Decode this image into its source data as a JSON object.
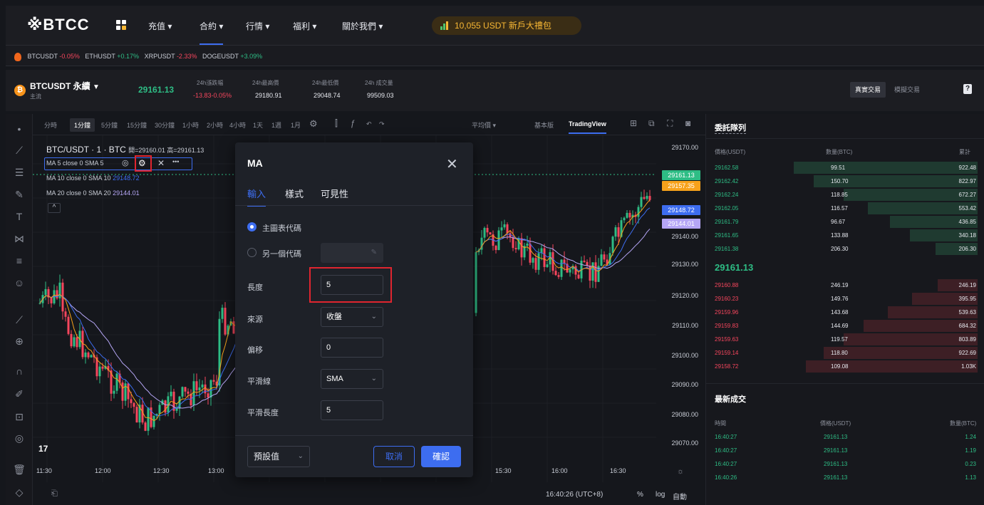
{
  "header": {
    "logo": "※BTCC",
    "nav": [
      "充值 ▾",
      "合約 ▾",
      "行情 ▾",
      "福利 ▾",
      "關於我們 ▾"
    ],
    "promo": "10,055 USDT 新戶大禮包"
  },
  "ticker": [
    {
      "sym": "BTCUSDT",
      "chg": "-0.05%",
      "dir": "neg"
    },
    {
      "sym": "ETHUSDT",
      "chg": "+0.17%",
      "dir": "pos"
    },
    {
      "sym": "XRPUSDT",
      "chg": "-2.33%",
      "dir": "neg"
    },
    {
      "sym": "DOGEUSDT",
      "chg": "+3.09%",
      "dir": "pos"
    }
  ],
  "info": {
    "pair": "BTCUSDT 永續",
    "sub": "主流",
    "price": "29161.13",
    "change_label": "24h漲跌幅",
    "change_value": "-13.83-0.05%",
    "high_label": "24h最高價",
    "high_value": "29180.91",
    "low_label": "24h最低價",
    "low_value": "29048.74",
    "vol_label": "24h 成交量",
    "vol_value": "99509.03",
    "real": "真實交易",
    "demo": "模擬交易",
    "help": "?"
  },
  "toolbar": {
    "intervals": [
      "分時",
      "1分鐘",
      "5分鐘",
      "15分鐘",
      "30分鐘",
      "1小時",
      "2小時",
      "4小時",
      "1天",
      "1週",
      "1月"
    ],
    "indicator": "平均價 ▾",
    "basic": "基本版",
    "tv": "TradingView"
  },
  "legend": {
    "title": "BTC/USDT · 1 · BTC",
    "ohlc": "開=29160.01 高=29161.13",
    "ma5": "MA 5 close 0 SMA 5",
    "ma10": "MA 10 close 0 SMA 10",
    "ma10_val": "29148.72",
    "ma20": "MA 20 close 0 SMA 20",
    "ma20_val": "29144.01"
  },
  "price_axis": [
    "29170.00",
    "29150.00",
    "29140.00",
    "29130.00",
    "29120.00",
    "29110.00",
    "29100.00",
    "29090.00",
    "29080.00",
    "29070.00"
  ],
  "price_tags": [
    {
      "v": "29161.13",
      "color": "#2ebd85"
    },
    {
      "v": "29157.35",
      "color": "#f7a21b"
    },
    {
      "v": "29148.72",
      "color": "#3d6df0"
    },
    {
      "v": "29144.01",
      "color": "#b5a6f5"
    }
  ],
  "time_axis": [
    "11:30",
    "12:00",
    "12:30",
    "13:00",
    "15:30",
    "16:00",
    "16:30"
  ],
  "footer": {
    "clock": "16:40:26 (UTC+8)",
    "pct": "%",
    "log": "log",
    "auto": "自動"
  },
  "modal": {
    "title": "MA",
    "tabs": [
      "輸入",
      "樣式",
      "可見性"
    ],
    "main_symbol": "主圖表代碼",
    "other_symbol": "另一個代碼",
    "length_label": "長度",
    "length_value": "5",
    "source_label": "來源",
    "source_value": "收盤",
    "offset_label": "偏移",
    "offset_value": "0",
    "smooth_label": "平滑線",
    "smooth_value": "SMA",
    "smooth_len_label": "平滑長度",
    "smooth_len_value": "5",
    "preset": "預設值",
    "cancel": "取消",
    "ok": "確認"
  },
  "orderbook": {
    "title": "委託隊列",
    "headers": [
      "價格(USDT)",
      "數量(BTC)",
      "累計"
    ],
    "asks": [
      [
        "29162.58",
        "99.51",
        "922.48",
        0.92
      ],
      [
        "29162.42",
        "150.70",
        "822.97",
        0.82
      ],
      [
        "29162.24",
        "118.85",
        "672.27",
        0.67
      ],
      [
        "29162.05",
        "116.57",
        "553.42",
        0.55
      ],
      [
        "29161.79",
        "96.67",
        "436.85",
        0.44
      ],
      [
        "29161.65",
        "133.88",
        "340.18",
        0.34
      ],
      [
        "29161.38",
        "206.30",
        "206.30",
        0.21
      ]
    ],
    "mid": "29161.13",
    "bids": [
      [
        "29160.88",
        "246.19",
        "246.19",
        0.2
      ],
      [
        "29160.23",
        "149.76",
        "395.95",
        0.33
      ],
      [
        "29159.96",
        "143.68",
        "539.63",
        0.45
      ],
      [
        "29159.83",
        "144.69",
        "684.32",
        0.57
      ],
      [
        "29159.63",
        "119.57",
        "803.89",
        0.67
      ],
      [
        "29159.14",
        "118.80",
        "922.69",
        0.77
      ],
      [
        "29158.72",
        "109.08",
        "1.03K",
        0.86
      ]
    ],
    "trades_title": "最新成交",
    "trades_headers": [
      "時間",
      "價格(USDT)",
      "數量(BTC)"
    ],
    "trades": [
      [
        "16:40:27",
        "29161.13",
        "1.24"
      ],
      [
        "16:40:27",
        "29161.13",
        "1.19"
      ],
      [
        "16:40:27",
        "29161.13",
        "0.23"
      ],
      [
        "16:40:26",
        "29161.13",
        "1.13"
      ]
    ]
  }
}
